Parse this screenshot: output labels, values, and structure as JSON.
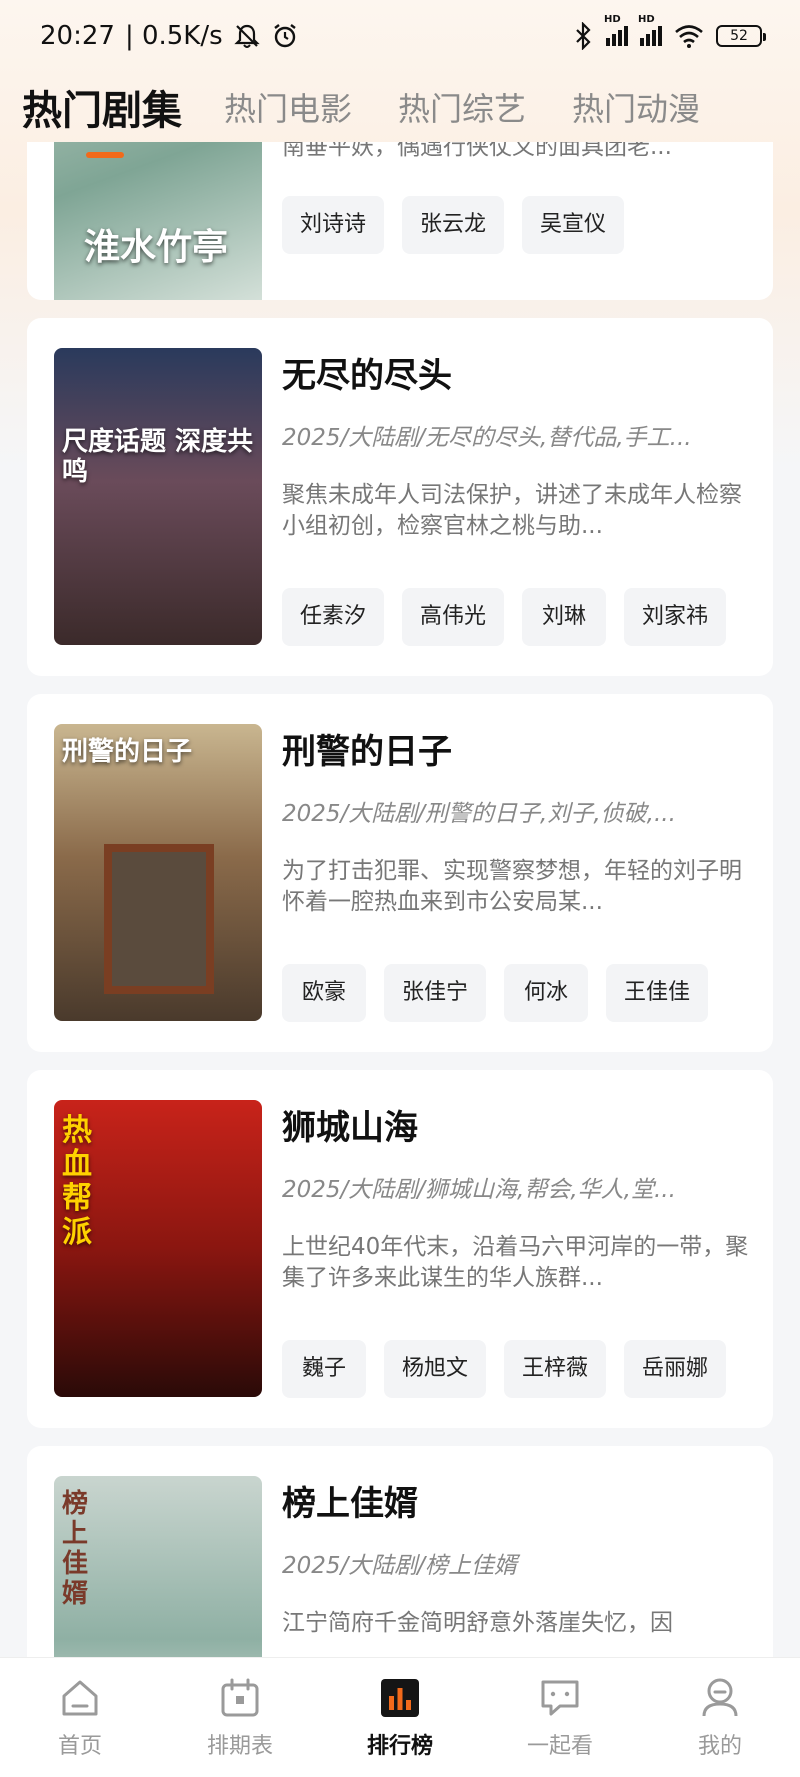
{
  "status": {
    "time": "20:27",
    "speed": "| 0.5K/s",
    "battery": "52",
    "hd1": "HD",
    "hd2": "HD",
    "icons": [
      "mute-bell-icon",
      "alarm-icon",
      "bluetooth-icon",
      "signal-icon",
      "wifi-icon",
      "battery-icon"
    ]
  },
  "tabs": [
    "热门剧集",
    "热门电影",
    "热门综艺",
    "热门动漫"
  ],
  "partial_card": {
    "poster_text": "淮水竹亭",
    "desc": "南垂平妖，偶遇行侠仗义的面具团老...",
    "cast": [
      "刘诗诗",
      "张云龙",
      "吴宣仪"
    ]
  },
  "cards": [
    {
      "title": "无尽的尽头",
      "meta": "2025/大陆剧/无尽的尽头,替代品,手工...",
      "desc": "聚焦未成年人司法保护，讲述了未成年人检察小组初创，检察官林之桃与助...",
      "cast": [
        "任素汐",
        "高伟光",
        "刘琳",
        "刘家祎"
      ],
      "poster_text": "尺度话题 深度共鸣"
    },
    {
      "title": "刑警的日子",
      "meta": "2025/大陆剧/刑警的日子,刘子,侦破,...",
      "desc": "为了打击犯罪、实现警察梦想，年轻的刘子明怀着一腔热血来到市公安局某...",
      "cast": [
        "欧豪",
        "张佳宁",
        "何冰",
        "王佳佳"
      ],
      "poster_text": "刑警的日子"
    },
    {
      "title": "狮城山海",
      "meta": "2025/大陆剧/狮城山海,帮会,华人,堂...",
      "desc": "上世纪40年代末，沿着马六甲河岸的一带，聚集了许多来此谋生的华人族群...",
      "cast": [
        "巍子",
        "杨旭文",
        "王梓薇",
        "岳丽娜"
      ],
      "poster_text": "热血帮派"
    },
    {
      "title": "榜上佳婿",
      "meta": "2025/大陆剧/榜上佳婿",
      "desc": "江宁简府千金简明舒意外落崖失忆，因",
      "cast": [],
      "poster_text": "榜上佳婿"
    }
  ],
  "bottom_nav": [
    {
      "label": "首页",
      "icon": "home-icon"
    },
    {
      "label": "排期表",
      "icon": "calendar-icon"
    },
    {
      "label": "排行榜",
      "icon": "ranking-icon",
      "active": true
    },
    {
      "label": "一起看",
      "icon": "chat-icon"
    },
    {
      "label": "我的",
      "icon": "profile-icon"
    }
  ],
  "colors": {
    "accent": "#f26a1b",
    "background": "#f5f6f8"
  }
}
